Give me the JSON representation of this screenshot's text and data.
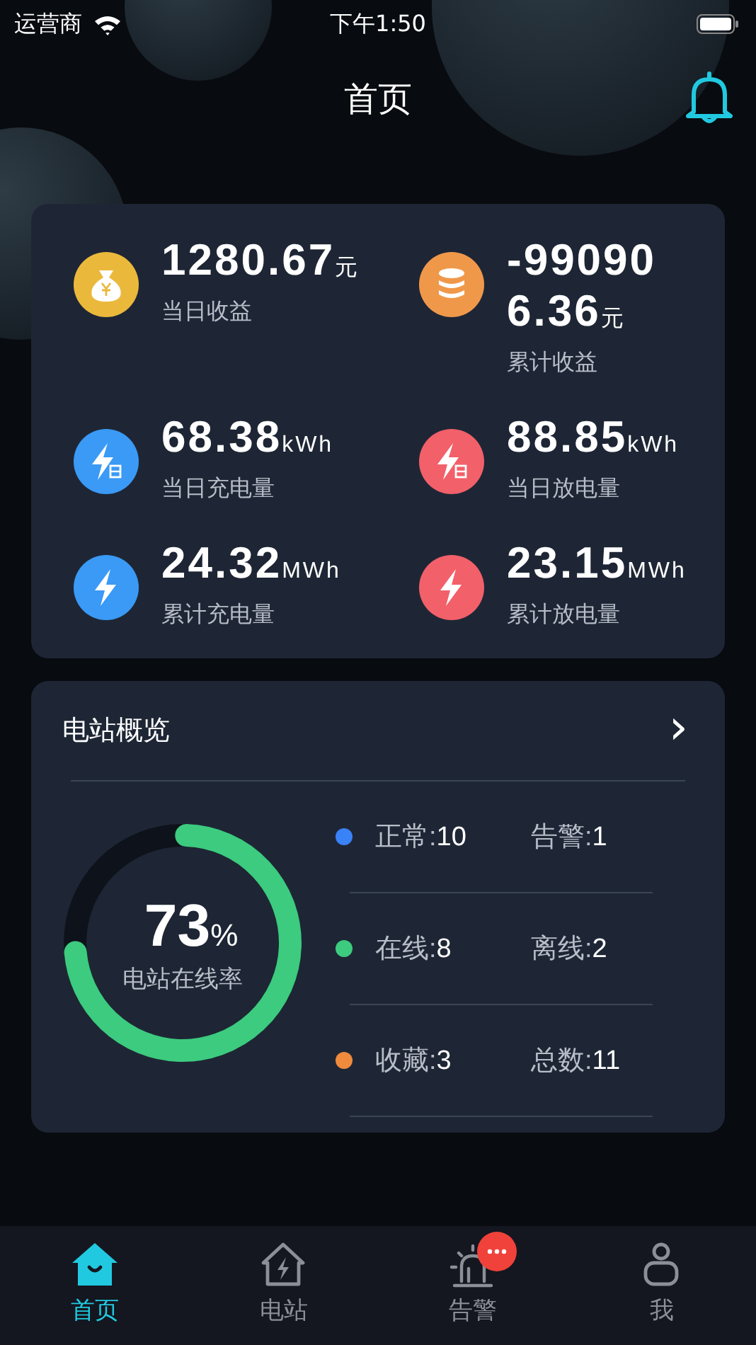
{
  "status_bar": {
    "carrier": "运营商",
    "time": "下午1:50"
  },
  "header": {
    "title": "首页"
  },
  "stats": [
    {
      "kind": "money",
      "color": "#eab93c",
      "value": "1280.67",
      "unit": "元",
      "label": "当日收益"
    },
    {
      "kind": "coins",
      "color": "#f0984a",
      "value": "-990906.36",
      "unit": "元",
      "label": "累计收益"
    },
    {
      "kind": "bolt_day",
      "color": "#3a9af5",
      "value": "68.38",
      "unit": "kWh",
      "label": "当日充电量"
    },
    {
      "kind": "bolt_day",
      "color": "#f2606a",
      "value": "88.85",
      "unit": "kWh",
      "label": "当日放电量"
    },
    {
      "kind": "bolt",
      "color": "#3a9af5",
      "value": "24.32",
      "unit": "MWh",
      "label": "累计充电量"
    },
    {
      "kind": "bolt",
      "color": "#f2606a",
      "value": "23.15",
      "unit": "MWh",
      "label": "累计放电量"
    }
  ],
  "overview": {
    "title": "电站概览",
    "chevron": "›",
    "rate": {
      "value": "73",
      "unit": "%",
      "label": "电站在线率",
      "level": 0.73
    },
    "rows": [
      {
        "color": "#3a82f7",
        "items": [
          {
            "label": "正常:",
            "value": "10"
          },
          {
            "label": "告警:",
            "value": "1"
          }
        ]
      },
      {
        "color": "#3ccb7f",
        "items": [
          {
            "label": "在线:",
            "value": "8"
          },
          {
            "label": "离线:",
            "value": "2"
          }
        ]
      },
      {
        "color": "#f08a3c",
        "items": [
          {
            "label": "收藏:",
            "value": "3"
          },
          {
            "label": "总数:",
            "value": "11"
          }
        ]
      }
    ]
  },
  "tabs": [
    {
      "kind": "home",
      "label": "首页",
      "selected": true
    },
    {
      "kind": "station",
      "label": "电站",
      "selected": false
    },
    {
      "kind": "alarm",
      "label": "告警",
      "selected": false,
      "badge": true
    },
    {
      "kind": "me",
      "label": "我",
      "selected": false
    }
  ]
}
